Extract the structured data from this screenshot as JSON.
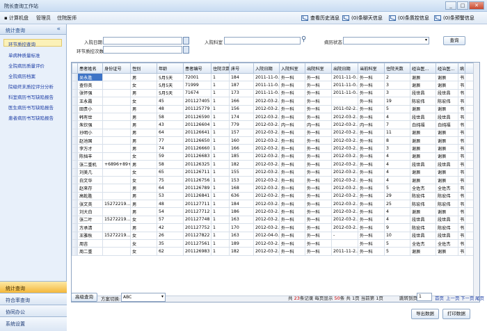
{
  "window": {
    "title": "院长查询工作站",
    "min": "_",
    "max": "□",
    "close": "✕"
  },
  "menu": {
    "items": [
      "计算机盘",
      "管理员",
      "住院医师"
    ]
  },
  "messages": [
    {
      "label": "查看历史消息"
    },
    {
      "label": "(0)条聊天信息"
    },
    {
      "label": "(0)条质控信息"
    },
    {
      "label": "(0)条预警信息"
    }
  ],
  "sidebar": {
    "header": "统计查询",
    "collapse": "«",
    "items": [
      "环节质控查询",
      "单病种质量标准",
      "全院病历质量评价",
      "全院病历档案",
      "院级终末质控评分分析",
      "科室病历书写缺陷报告",
      "医生病历书写缺陷报告",
      "患者病历书写缺陷报告"
    ],
    "bottom": [
      "统计查询",
      "符合率查询",
      "协同办公",
      "系统设置"
    ]
  },
  "filters": {
    "admit_date_label": "入院日期",
    "admit_dept_label": "入院科室",
    "status_label": "病历状态",
    "checks_label": "环节质控次数",
    "query_button": "查询"
  },
  "grid": {
    "columns": [
      "患者姓名",
      "身份证号",
      "性别",
      "年龄",
      "患者编号",
      "住院次数",
      "床号",
      "入院日期",
      "入院科室",
      "出院科室",
      "出院日期",
      "当前科室",
      "住院天数",
      "经治医...",
      "经治医...",
      "病"
    ],
    "rows": [
      [
        "吴永胜",
        "",
        "男",
        "5月5天",
        "72001",
        "1",
        "184",
        "2011-11-0...",
        "外一科",
        "外一科",
        "2011-11-0...",
        "外一科",
        "2",
        "谢辰",
        "谢辰",
        "书"
      ],
      [
        "查你英",
        "",
        "女",
        "5月5天",
        "71999",
        "1",
        "187",
        "2011-11-0...",
        "外一科",
        "外一科",
        "2011-11-0...",
        "外一科",
        "3",
        "谢辰",
        "谢辰",
        "书"
      ],
      [
        "张怀强",
        "",
        "男",
        "5月5天",
        "71674",
        "1",
        "173",
        "2011-11-0...",
        "外一科",
        "外一科",
        "2011-11-0...",
        "外一科",
        "3",
        "段世昌",
        "段世昌",
        "书"
      ],
      [
        "王永霞",
        "",
        "女",
        "45",
        "201127405",
        "1",
        "166",
        "2012-03-2...",
        "外一科",
        "外一科",
        "",
        "外一科",
        "19",
        "陈宏伟",
        "陈宏伟",
        "书"
      ],
      [
        "田贵小",
        "",
        "男",
        "48",
        "201125779",
        "1",
        "156",
        "2012-03-2...",
        "外一科",
        "外一科",
        "2011-02-2...",
        "外一科",
        "5",
        "谢辰",
        "谢辰",
        "书"
      ],
      [
        "韩有世",
        "",
        "男",
        "58",
        "201126590",
        "1",
        "174",
        "2012-03-2...",
        "外一科",
        "外一科",
        "2012-03-2...",
        "外一科",
        "4",
        "段世昌",
        "段世昌",
        "书"
      ],
      [
        "朱钦强",
        "",
        "男",
        "43",
        "201126604",
        "1",
        "779",
        "2012-03-2...",
        "内一科",
        "内一科",
        "2012-03-2...",
        "内一科",
        "7",
        "白纯福",
        "白纯福",
        "书"
      ],
      [
        "孙明小",
        "",
        "男",
        "64",
        "201126641",
        "1",
        "157",
        "2012-03-2...",
        "外一科",
        "外一科",
        "2012-03-2...",
        "外一科",
        "11",
        "谢辰",
        "谢辰",
        "书"
      ],
      [
        "赵池国",
        "",
        "男",
        "77",
        "201126650",
        "1",
        "160",
        "2012-03-2...",
        "外一科",
        "外一科",
        "2012-03-2...",
        "外一科",
        "8",
        "谢辰",
        "谢辰",
        "书"
      ],
      [
        "李万才",
        "",
        "男",
        "74",
        "201126660",
        "1",
        "166",
        "2012-03-2...",
        "外一科",
        "外一科",
        "2012-03-2...",
        "外一科",
        "3",
        "谢辰",
        "谢辰",
        "书"
      ],
      [
        "陈挡丰",
        "",
        "女",
        "59",
        "201126683",
        "1",
        "185",
        "2012-03-2...",
        "外一科",
        "外一科",
        "2012-03-2...",
        "外一科",
        "4",
        "谢辰",
        "谢辰",
        "书"
      ],
      [
        "张二重机",
        "+6896+89+",
        "男",
        "58",
        "201126325",
        "1",
        "182",
        "2012-03-2...",
        "外一科",
        "外一科",
        "2012-03-2...",
        "外一科",
        "4",
        "段世昌",
        "段世昌",
        "书"
      ],
      [
        "刘美几",
        "",
        "女",
        "65",
        "201126711",
        "1",
        "155",
        "2012-03-2...",
        "外一科",
        "外一科",
        "2012-03-2...",
        "外一科",
        "4",
        "谢辰",
        "谢辰",
        "书"
      ],
      [
        "白文华",
        "",
        "女",
        "75",
        "201126756",
        "1",
        "153",
        "2012-03-2...",
        "外一科",
        "外一科",
        "2012-03-2...",
        "外一科",
        "4",
        "谢辰",
        "谢辰",
        "书"
      ],
      [
        "赵来存",
        "",
        "男",
        "64",
        "201126789",
        "1",
        "168",
        "2012-03-2...",
        "外一科",
        "外一科",
        "2012-03-2...",
        "外一科",
        "5",
        "全佐杰",
        "全佐杰",
        "书"
      ],
      [
        "高乾胜",
        "",
        "男",
        "53",
        "201126841",
        "1",
        "636",
        "2012-03-2...",
        "外一科",
        "外一科",
        "2012-03-2...",
        "外一科",
        "29",
        "陈宏伟",
        "陈宏伟",
        "书"
      ],
      [
        "张文英",
        "15272219...",
        "男",
        "48",
        "201127711",
        "1",
        "184",
        "2012-03-2...",
        "外一科",
        "外一科",
        "2012-03-2...",
        "外一科",
        "25",
        "陈宏伟",
        "陈宏伟",
        "书"
      ],
      [
        "刘大白",
        "",
        "男",
        "54",
        "201127712",
        "1",
        "186",
        "2012-03-2...",
        "外一科",
        "外一科",
        "2012-03-2...",
        "外一科",
        "4",
        "谢辰",
        "谢辰",
        "书"
      ],
      [
        "张二叶",
        "15272219...",
        "女",
        "57",
        "201127748",
        "1",
        "163",
        "2012-03-2...",
        "外一科",
        "外一科",
        "2012-03-2...",
        "外一科",
        "4",
        "段世昌",
        "段世昌",
        "书"
      ],
      [
        "方承清",
        "",
        "男",
        "42",
        "201127752",
        "1",
        "170",
        "2012-03-2...",
        "外一科",
        "外一科",
        "2012-03-2...",
        "外一科",
        "9",
        "陈宏伟",
        "陈宏伟",
        "书"
      ],
      [
        "王雅秋",
        "15272219...",
        "女",
        "26",
        "201127822",
        "1",
        "163",
        "2012-04-0...",
        "外一科",
        "外一科",
        "-",
        "外一科",
        "10",
        "段世昌",
        "段世昌",
        "书"
      ],
      [
        "周吉",
        "",
        "女",
        "35",
        "201127561",
        "1",
        "189",
        "2012-03-2...",
        "外一科",
        "外一科",
        "",
        "外一科",
        "5",
        "全佐杰",
        "全佐杰",
        "书"
      ],
      [
        "周二重",
        "",
        "女",
        "62",
        "201126983",
        "1",
        "182",
        "2012-03-2...",
        "外一科",
        "外一科",
        "2011-11-2...",
        "外一科",
        "5",
        "谢辰",
        "谢辰",
        "书"
      ]
    ]
  },
  "footer": {
    "advanced_button": "高级查询",
    "scheme_label": "方案切换:",
    "scheme_value": "ABC",
    "pager": {
      "total_prefix": "共",
      "total": "23",
      "total_suffix": "条记录 每页显示",
      "per_page": "50",
      "per_page_suffix": "条 共",
      "pages": "1",
      "pages_suffix": "页 当前第",
      "current": "1",
      "current_suffix": "页"
    },
    "jump_label": "跳转到页:",
    "jump_value": "1",
    "nav": [
      "首页",
      "上一页",
      "下一页",
      "尾页"
    ],
    "export_button": "导出数据",
    "print_button": "打印数据"
  }
}
